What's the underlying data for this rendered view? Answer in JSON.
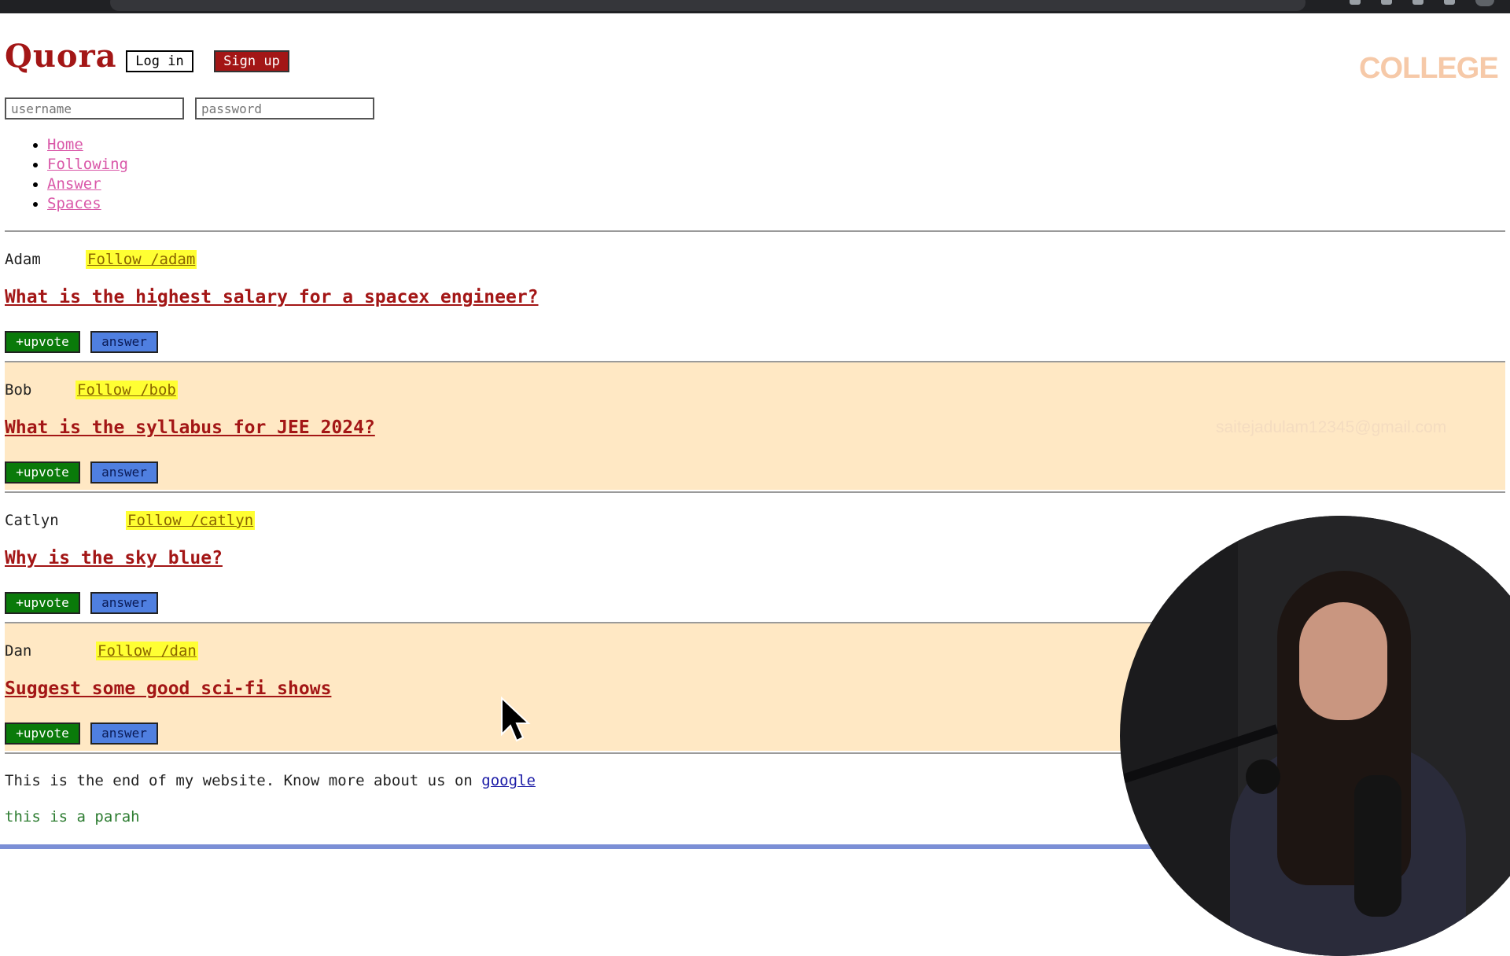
{
  "site": {
    "logo": "Quora",
    "login_label": "Log in",
    "signup_label": "Sign up",
    "username_placeholder": "username",
    "password_placeholder": "password"
  },
  "nav": [
    "Home",
    "Following",
    "Answer",
    "Spaces"
  ],
  "posts": [
    {
      "author": "Adam",
      "follow": "Follow /adam",
      "question": "What is the highest salary for a spacex engineer?",
      "upvote": "+upvote",
      "answer": "answer"
    },
    {
      "author": "Bob",
      "follow": "Follow /bob",
      "question": "What is the syllabus for JEE 2024?",
      "upvote": "+upvote",
      "answer": "answer"
    },
    {
      "author": "Catlyn",
      "follow": "Follow /catlyn",
      "question": "Why is the sky blue?",
      "upvote": "+upvote",
      "answer": "answer"
    },
    {
      "author": "Dan",
      "follow": "Follow /dan",
      "question": "Suggest some good sci-fi shows",
      "upvote": "+upvote",
      "answer": "answer"
    }
  ],
  "footer": {
    "text": "This is the end of my website. Know more about us on ",
    "link": "google",
    "para": "this is a parah"
  },
  "overlay": {
    "watermark_logo": "COLLEGE",
    "watermark_email": "saitejadulam12345@gmail.com"
  },
  "colors": {
    "brand": "#a31616",
    "nav_link": "#d957a8",
    "follow_bg": "#ffff33",
    "alt_row_bg": "#ffe8c4",
    "upvote_bg": "#0a7a0a",
    "answer_bg": "#4f7fe0",
    "para": "#2e7d32"
  }
}
